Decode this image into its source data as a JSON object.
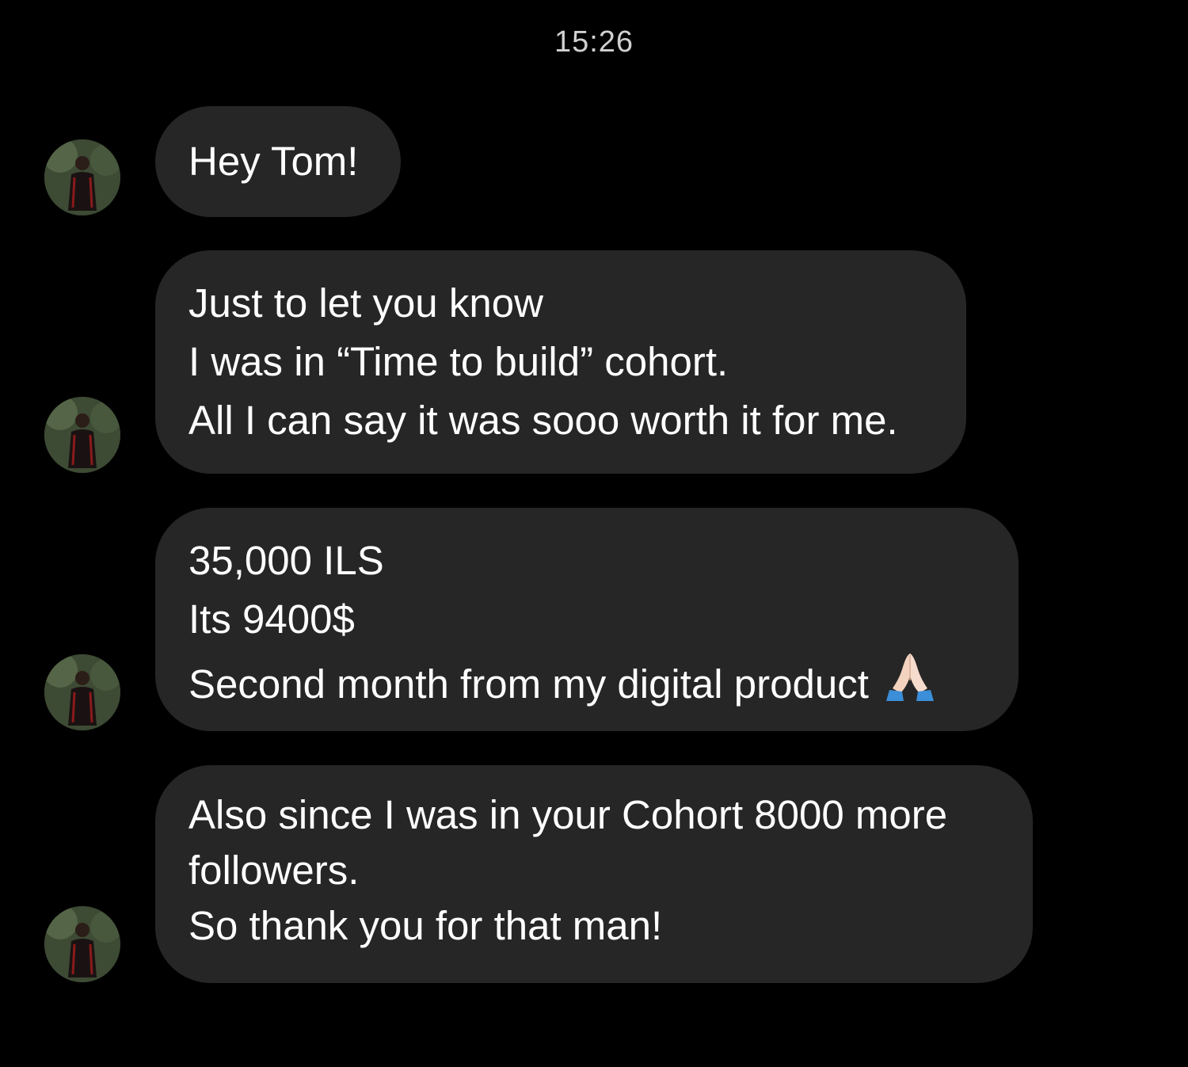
{
  "conversation": {
    "timestamp": "15:26",
    "messages": [
      {
        "lines": [
          "Hey Tom!"
        ]
      },
      {
        "lines": [
          "Just to let you know",
          "I was in “Time to build” cohort.",
          "All I can say it was sooo worth it for me."
        ]
      },
      {
        "lines": [
          "35,000 ILS",
          "Its 9400$",
          "Second month from my digital product"
        ],
        "emoji": "folded-hands-icon"
      },
      {
        "lines": [
          "Also since I was in your Cohort 8000 more",
          "followers.",
          "So thank you for that man!"
        ]
      }
    ]
  },
  "colors": {
    "background": "#000000",
    "bubble": "#262626",
    "text": "#ffffff",
    "timestamp": "#d0d0d0"
  }
}
